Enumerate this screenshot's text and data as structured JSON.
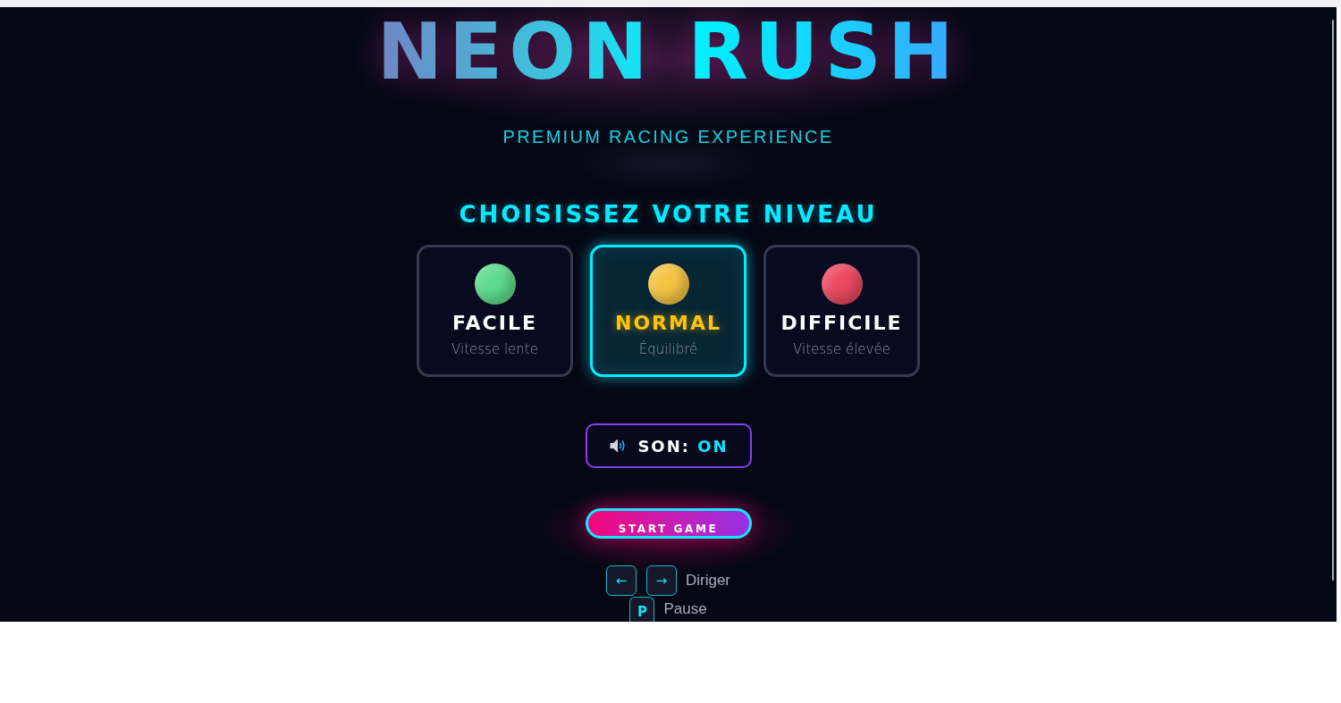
{
  "title": "NEON RUSH",
  "subtitle": "PREMIUM RACING EXPERIENCE",
  "level_picker": {
    "heading": "CHOISISSEZ VOTRE NIVEAU",
    "levels": [
      {
        "name": "FACILE",
        "description": "Vitesse lente",
        "color": "#5edb8e",
        "selected": false
      },
      {
        "name": "NORMAL",
        "description": "Équilibré",
        "color": "#f5c445",
        "selected": true
      },
      {
        "name": "DIFFICILE",
        "description": "Vitesse élevée",
        "color": "#ec4a62",
        "selected": false
      }
    ]
  },
  "sound_toggle": {
    "label": "SON:",
    "value": "ON",
    "on": true
  },
  "start_button": "START GAME",
  "controls": [
    {
      "keys": [
        "←",
        "→"
      ],
      "action": "Diriger"
    },
    {
      "keys": [
        "P"
      ],
      "action": "Pause"
    }
  ]
}
